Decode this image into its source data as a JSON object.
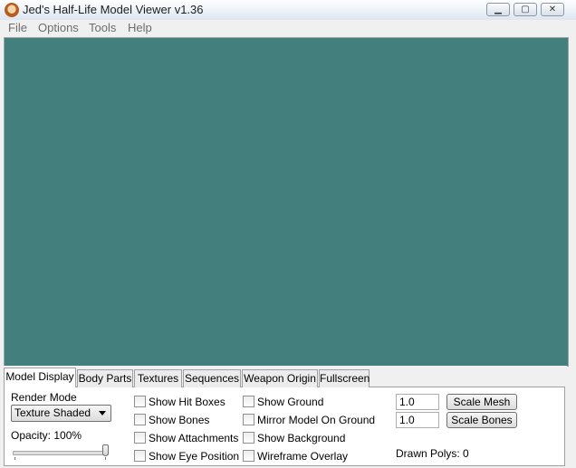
{
  "window": {
    "title": "Jed's Half-Life Model Viewer v1.36"
  },
  "menu": [
    "File",
    "Options",
    "Tools",
    "Help"
  ],
  "viewport": {
    "background_color": "#427f7d"
  },
  "tabs": [
    "Model Display",
    "Body Parts",
    "Textures",
    "Sequences",
    "Weapon Origin",
    "Fullscreen"
  ],
  "active_tab": "Model Display",
  "model_display": {
    "render_mode_label": "Render Mode",
    "render_mode_value": "Texture Shaded",
    "opacity_label": "Opacity: 100%",
    "opacity_value": 1.0,
    "checkboxes_col1": [
      "Show Hit Boxes",
      "Show Bones",
      "Show Attachments",
      "Show Eye Position"
    ],
    "checkboxes_col2": [
      "Show Ground",
      "Mirror Model On Ground",
      "Show Background",
      "Wireframe Overlay"
    ],
    "scale_mesh_value": "1.0",
    "scale_mesh_button": "Scale Mesh",
    "scale_bones_value": "1.0",
    "scale_bones_button": "Scale Bones",
    "drawn_polys": "Drawn Polys: 0"
  }
}
